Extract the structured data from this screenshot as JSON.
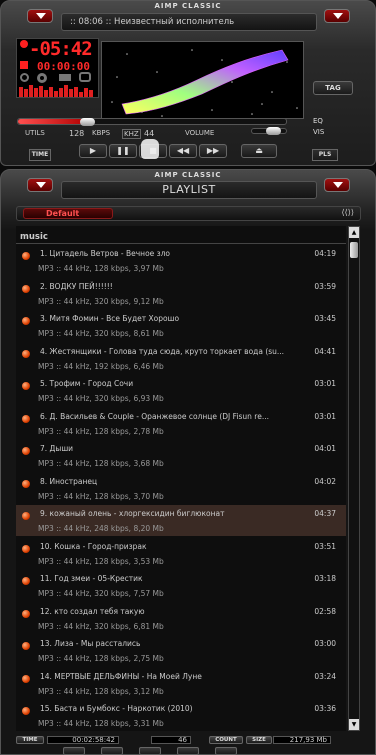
{
  "player": {
    "caption": "AIMP CLASSIC",
    "title": ":: 08:06 :: Неизвестный исполнитель",
    "time_main": "-05:42",
    "time_sub": "00:00:00",
    "bitrate": "128",
    "bitrate_unit": "KBPS",
    "khz": "44",
    "khz_unit": "KHZ",
    "volume_label": "VOLUME",
    "utils_label": "UTILS",
    "time_label": "TIME",
    "eq_label": "EQ",
    "vis_label": "VIS",
    "tag_label": "TAG",
    "pls_label": "PLS",
    "seek_position": 0.26,
    "volume_level": 0.9
  },
  "playlist": {
    "caption": "AIMP CLASSIC",
    "title": "PLAYLIST",
    "tab_label": "Default",
    "group_label": "music",
    "selected_index": 8,
    "tracks": [
      {
        "title": "1. Цитадель Ветров - Вечное зло",
        "duration": "04:19",
        "info": "MP3 :: 44 kHz, 128 kbps, 3,97 Mb"
      },
      {
        "title": "2. ВОДКУ ПЕЙ!!!!!!",
        "duration": "03:59",
        "info": "MP3 :: 44 kHz, 320 kbps, 9,12 Mb"
      },
      {
        "title": "3. Митя Фомин - Все Будет Хорошо",
        "duration": "03:45",
        "info": "MP3 :: 44 kHz, 320 kbps, 8,61 Mb"
      },
      {
        "title": "4. Жестянщики - Голова туда сюда, круто торкает вода (su...",
        "duration": "04:41",
        "info": "MP3 :: 44 kHz, 192 kbps, 6,46 Mb"
      },
      {
        "title": "5. Трофим - Город Сочи",
        "duration": "03:01",
        "info": "MP3 :: 44 kHz, 320 kbps, 6,93 Mb"
      },
      {
        "title": "6. Д. Васильев & Couple - Оранжевое солнце (DJ Fisun re...",
        "duration": "03:01",
        "info": "MP3 :: 44 kHz, 128 kbps, 2,78 Mb"
      },
      {
        "title": "7. Дыши",
        "duration": "04:01",
        "info": "MP3 :: 44 kHz, 128 kbps, 3,68 Mb"
      },
      {
        "title": "8. Иностранец",
        "duration": "04:02",
        "info": "MP3 :: 44 kHz, 128 kbps, 3,70 Mb"
      },
      {
        "title": "9. кожаный олень - хлоргексидин биглюконат",
        "duration": "04:37",
        "info": "MP3 :: 44 kHz, 248 kbps, 8,20 Mb"
      },
      {
        "title": "10. Кошка - Город-призрак",
        "duration": "03:51",
        "info": "MP3 :: 44 kHz, 128 kbps, 3,53 Mb"
      },
      {
        "title": "11. Год змеи - 05-Крестик",
        "duration": "03:18",
        "info": "MP3 :: 44 kHz, 320 kbps, 7,57 Mb"
      },
      {
        "title": "12. кто создал тебя такую",
        "duration": "02:58",
        "info": "MP3 :: 44 kHz, 320 kbps, 6,81 Mb"
      },
      {
        "title": "13. Лиза - Мы расстались",
        "duration": "03:00",
        "info": "MP3 :: 44 kHz, 128 kbps, 2,75 Mb"
      },
      {
        "title": "14. МЕРТВЫЕ ДЕЛЬФИНЫ - На Моей Луне",
        "duration": "03:24",
        "info": "MP3 :: 44 kHz, 128 kbps, 3,12 Mb"
      },
      {
        "title": "15. Баста и Бумбокс - Наркотик (2010)",
        "duration": "03:36",
        "info": "MP3 :: 44 kHz, 128 kbps, 3,31 Mb"
      }
    ],
    "footer": {
      "time_label": "TIME",
      "time_value": "00:02:58:42",
      "count_value": "46",
      "count_label": "COUNT",
      "size_label": "SIZE",
      "size_value": "217,93 Mb"
    }
  },
  "colors": {
    "accent": "#ff2a2a",
    "selected_row": "#3a2a24"
  }
}
